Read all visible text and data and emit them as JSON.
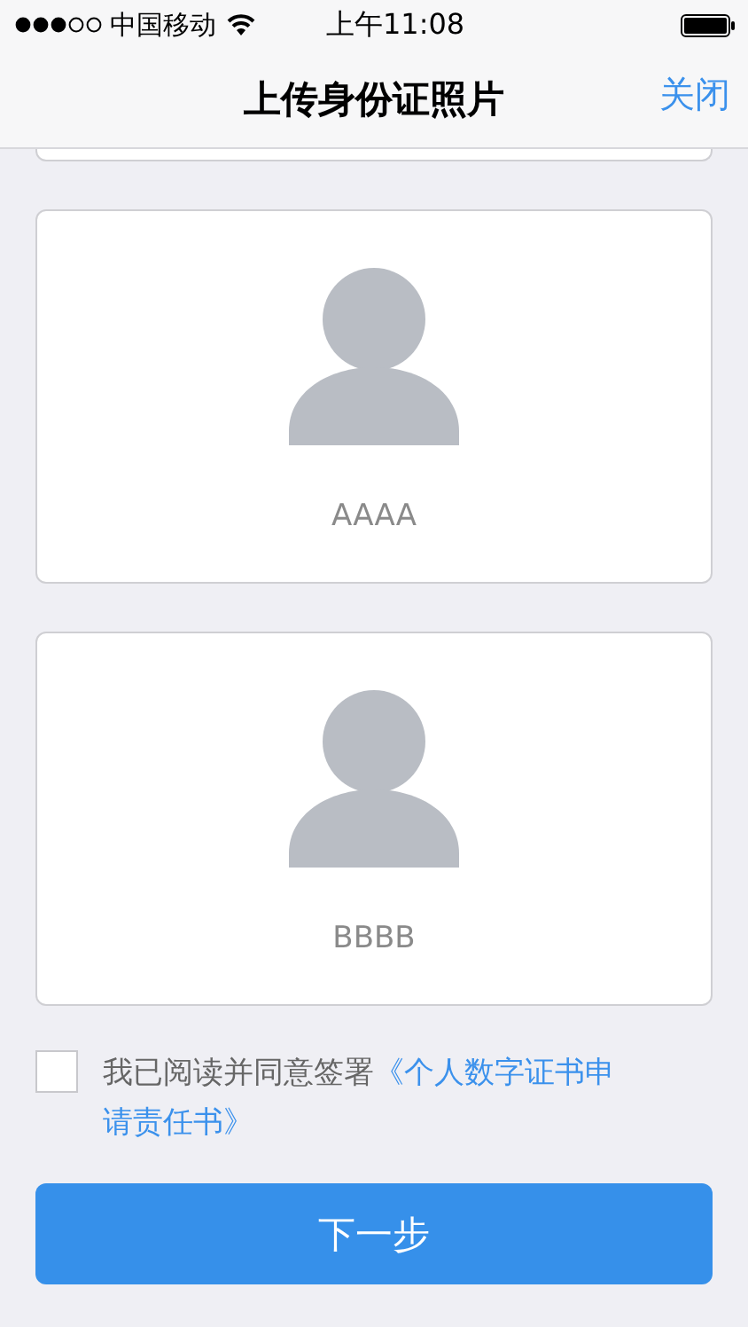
{
  "status_bar": {
    "carrier": "中国移动",
    "time": "上午11:08"
  },
  "nav": {
    "title": "上传身份证照片",
    "close": "关闭"
  },
  "cards": [
    {
      "label": "AAAA"
    },
    {
      "label": "BBBB"
    }
  ],
  "agreement": {
    "checked": false,
    "text": "我已阅读并同意签署",
    "link_lines": [
      "《个人数字证书申",
      "请责任书》"
    ]
  },
  "next_button": "下一步"
}
